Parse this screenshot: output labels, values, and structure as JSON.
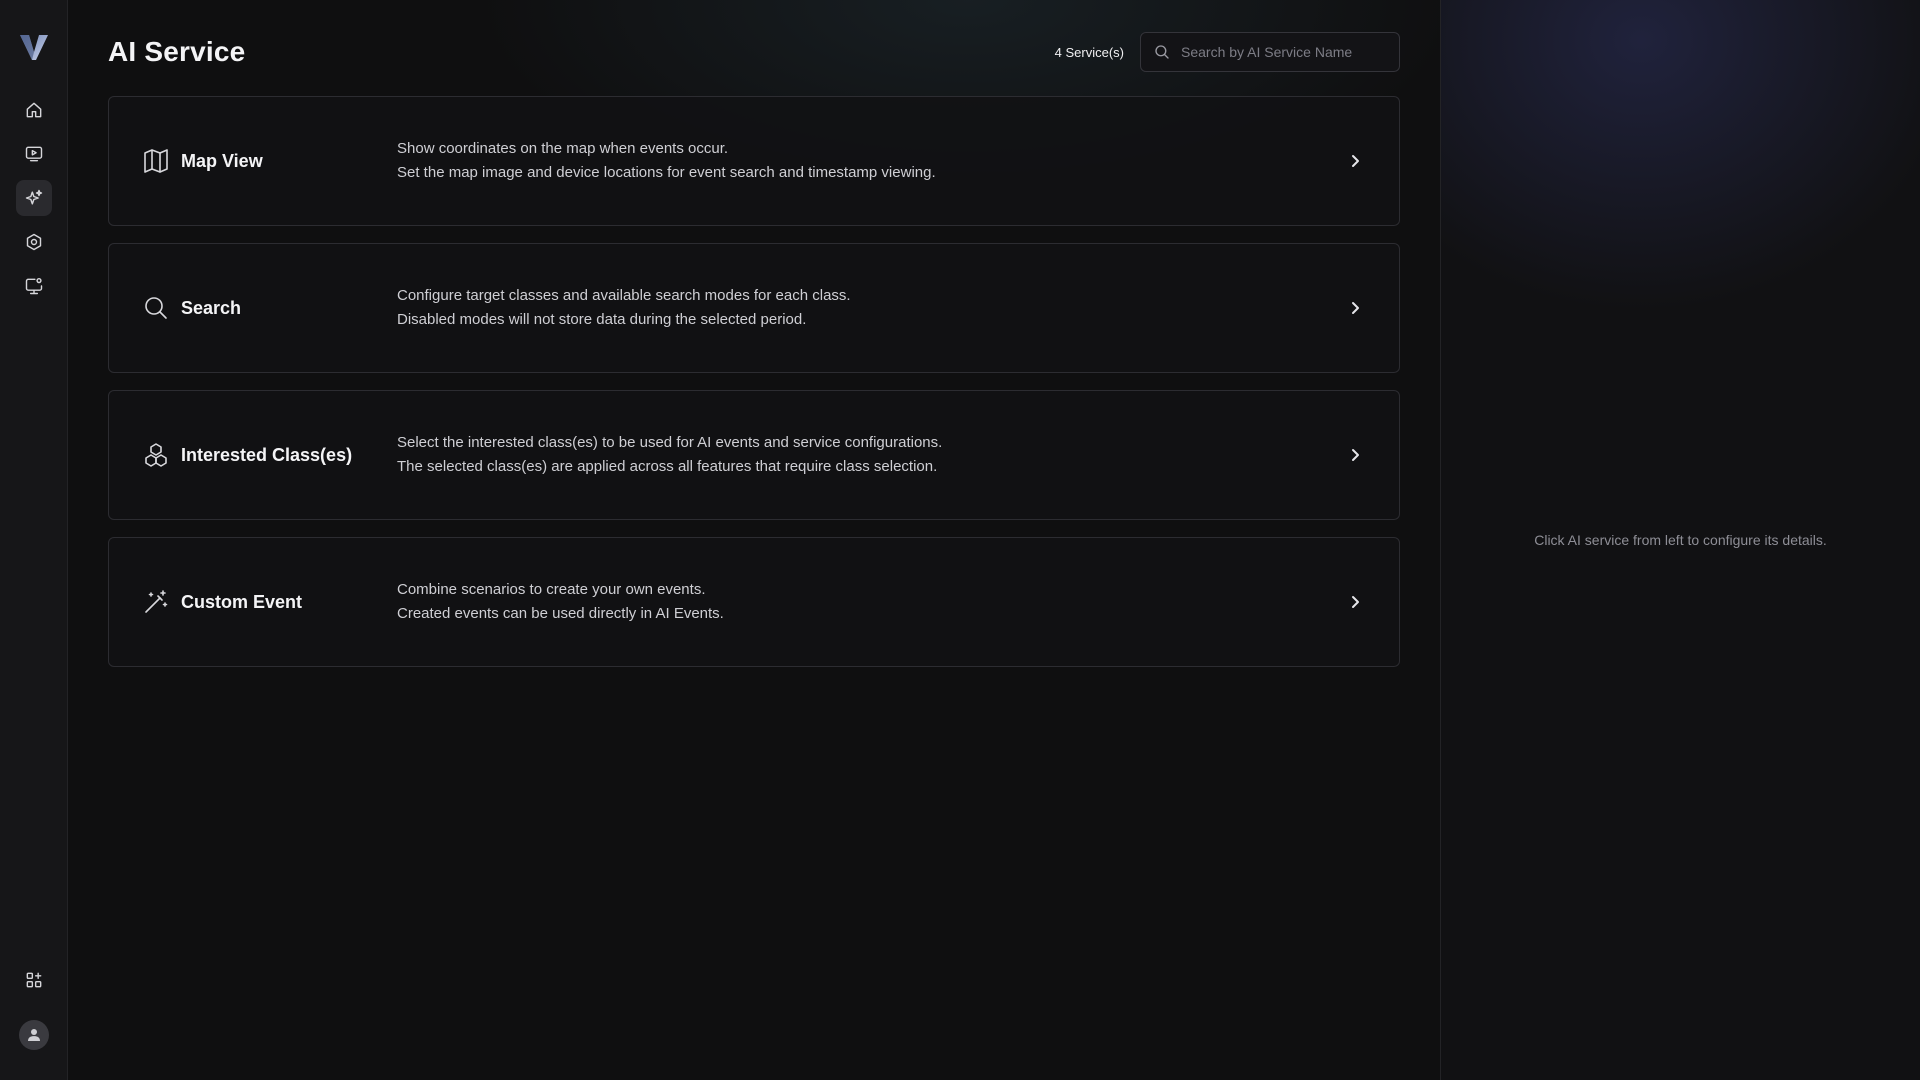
{
  "sidebar": {
    "logo": "V",
    "nav": [
      {
        "name": "home",
        "icon": "home-icon",
        "active": false
      },
      {
        "name": "playback",
        "icon": "video-play-icon",
        "active": false
      },
      {
        "name": "ai-service",
        "icon": "sparkles-icon",
        "active": true
      },
      {
        "name": "settings",
        "icon": "gear-icon",
        "active": false
      },
      {
        "name": "device-settings",
        "icon": "monitor-gear-icon",
        "active": false
      }
    ],
    "bottom": [
      {
        "name": "apps",
        "icon": "apps-add-icon"
      },
      {
        "name": "user",
        "icon": "user-avatar-icon"
      }
    ]
  },
  "header": {
    "title": "AI Service",
    "count": "4 Service(s)",
    "search_placeholder": "Search by AI Service Name",
    "search_value": ""
  },
  "services": [
    {
      "title": "Map View",
      "icon": "map-icon",
      "desc_line1": "Show coordinates on the map when events occur.",
      "desc_line2": "Set the map image and device locations for event search and timestamp viewing."
    },
    {
      "title": "Search",
      "icon": "search-icon",
      "desc_line1": "Configure target classes and available search modes for each class.",
      "desc_line2": "Disabled modes will not store data during the selected period."
    },
    {
      "title": "Interested Class(es)",
      "icon": "cubes-icon",
      "desc_line1": "Select the interested class(es) to be used for AI events and service configurations.",
      "desc_line2": "The selected class(es) are applied across all features that require class selection."
    },
    {
      "title": "Custom Event",
      "icon": "magic-wand-icon",
      "desc_line1": "Combine scenarios to create your own events.",
      "desc_line2": "Created events can be used directly in AI Events."
    }
  ],
  "detail_panel": {
    "hint": "Click AI service from left to configure its details."
  }
}
